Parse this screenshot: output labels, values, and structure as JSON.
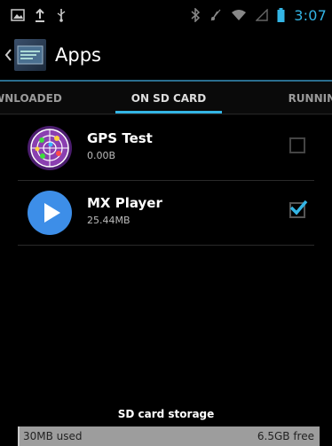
{
  "status_bar": {
    "time": "3:07",
    "left_icons": [
      "picture-icon",
      "upload-icon",
      "usb-icon"
    ],
    "right_icons": [
      "bluetooth-icon",
      "mute-icon",
      "wifi-icon",
      "signal-icon",
      "battery-icon"
    ],
    "accent_color": "#33b5e5"
  },
  "action_bar": {
    "title": "Apps"
  },
  "tabs": [
    {
      "label": "WNLOADED"
    },
    {
      "label": "ON SD CARD",
      "selected": true
    },
    {
      "label": "RUNNING"
    }
  ],
  "apps": [
    {
      "name": "GPS Test",
      "size": "0.00B",
      "checked": false,
      "icon": "gps-test-app-icon"
    },
    {
      "name": "MX Player",
      "size": "25.44MB",
      "checked": true,
      "icon": "mx-player-app-icon"
    }
  ],
  "storage": {
    "label": "SD card storage",
    "used": "30MB used",
    "free": "6.5GB free",
    "used_fraction": 0.005
  }
}
